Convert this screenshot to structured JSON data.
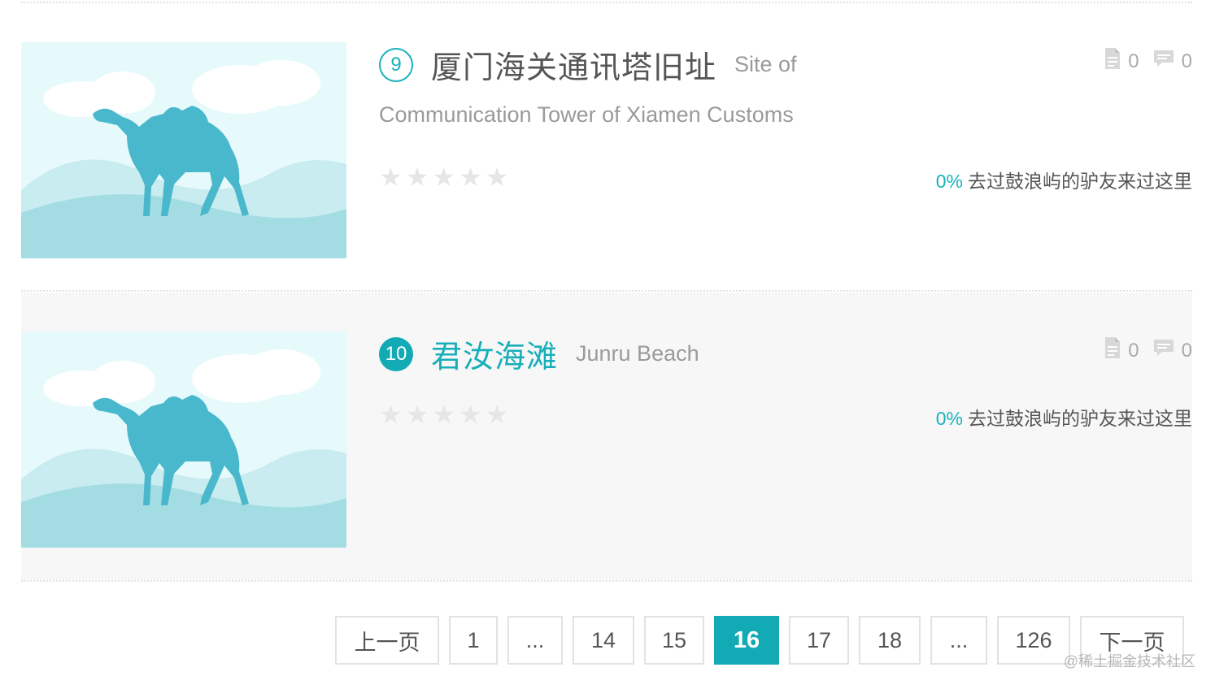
{
  "items": [
    {
      "rank": "9",
      "name_cn": "厦门海关通讯塔旧址",
      "name_en_part1": "Site of",
      "name_en_part2": "Communication Tower of Xiamen Customs",
      "doc_count": "0",
      "comment_count": "0",
      "visited_pct": "0%",
      "visited_text": "去过鼓浪屿的驴友来过这里",
      "rating": 0
    },
    {
      "rank": "10",
      "name_cn": "君汝海滩",
      "name_en": "Junru Beach",
      "doc_count": "0",
      "comment_count": "0",
      "visited_pct": "0%",
      "visited_text": "去过鼓浪屿的驴友来过这里",
      "rating": 0
    }
  ],
  "icons": {
    "stars": [
      "star-icon",
      "star-icon",
      "star-icon",
      "star-icon",
      "star-icon"
    ],
    "doc": "document-icon",
    "comment": "comment-icon",
    "thumb": "camel-placeholder-image"
  },
  "pagination": {
    "prev": "上一页",
    "pages": [
      "1",
      "...",
      "14",
      "15",
      "16",
      "17",
      "18",
      "...",
      "126"
    ],
    "current": "16",
    "next": "下一页"
  },
  "watermark": "@稀土掘金技术社区",
  "colors": {
    "accent": "#12aab5",
    "star_empty": "#e6e6e6",
    "hover_bg": "#f7f7f7"
  }
}
